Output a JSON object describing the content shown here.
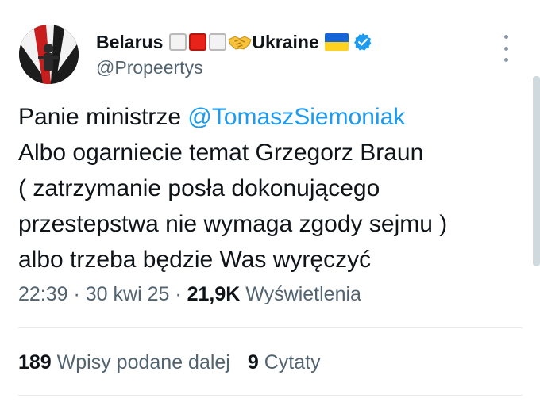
{
  "author": {
    "name_prefix": "Belarus",
    "name_suffix": "Ukraine",
    "handle": "@Propeertys",
    "emoji_icons": [
      "white-square-icon",
      "red-square-icon",
      "white-square-icon",
      "handshake-icon",
      "ukraine-flag-icon"
    ],
    "verified_badge": "verified-icon"
  },
  "tweet": {
    "mention": "@TomaszSiemoniak",
    "lines": [
      "Panie ministrze ",
      "Albo ogarniecie temat Grzegorz Braun",
      "( zatrzymanie posła dokonującego",
      "przestepstwa nie wymaga zgody sejmu )",
      "albo trzeba będzie Was wyręczyć"
    ]
  },
  "meta": {
    "time": "22:39",
    "separator": " · ",
    "date": "30 kwi 25",
    "views_count": "21,9K",
    "views_label": "Wyświetlenia"
  },
  "stats": {
    "retweets_count": "189",
    "retweets_label": "Wpisy podane dalej",
    "quotes_count": "9",
    "quotes_label": "Cytaty"
  },
  "colors": {
    "text": "#0f1419",
    "secondary": "#536471",
    "accent": "#1d9bf0",
    "divider": "#e7e9ea"
  }
}
